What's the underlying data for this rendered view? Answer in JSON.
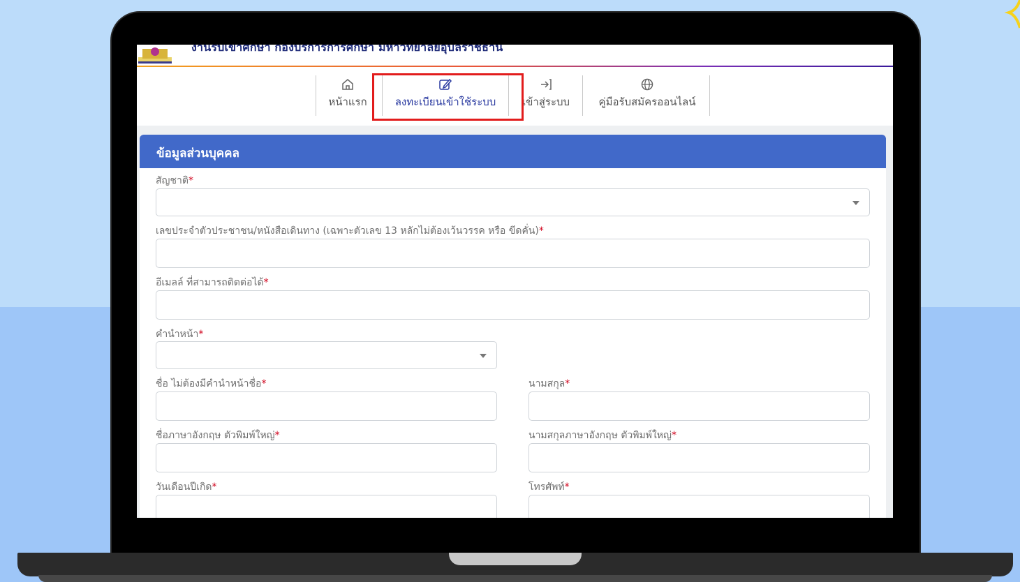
{
  "site": {
    "title": "งานรับเข้าศึกษา กองบริการการศึกษา มหาวิทยาลัยอุบลราชธานี",
    "logo_icon": "university-logo"
  },
  "nav": {
    "items": [
      {
        "label": "หน้าแรก",
        "icon": "home-icon"
      },
      {
        "label": "ลงทะเบียนเข้าใช้ระบบ",
        "icon": "edit-icon"
      },
      {
        "label": "เข้าสู่ระบบ",
        "icon": "login-icon"
      },
      {
        "label": "คู่มือรับสมัครออนไลน์",
        "icon": "globe-icon"
      }
    ],
    "active_index": 1
  },
  "form": {
    "section_title": "ข้อมูลส่วนบุคคล",
    "required_mark": "*",
    "fields": {
      "nationality": {
        "label": "สัญชาติ",
        "value": ""
      },
      "id_number": {
        "label": "เลขประจำตัวประชาชน/หนังสือเดินทาง   (เฉพาะตัวเลข 13 หลักไม่ต้องเว้นวรรค หรือ ขีดคั่น)",
        "value": ""
      },
      "email": {
        "label": "อีเมลล์ ที่สามารถติดต่อได้",
        "value": ""
      },
      "prefix": {
        "label": "คำนำหน้า",
        "value": ""
      },
      "first_name": {
        "label": "ชื่อ  ไม่ต้องมีคำนำหน้าชื่อ",
        "value": ""
      },
      "last_name": {
        "label": "นามสกุล",
        "value": ""
      },
      "first_name_en": {
        "label": "ชื่อภาษาอังกฤษ  ตัวพิมพ์ใหญ่",
        "value": ""
      },
      "last_name_en": {
        "label": "นามสกุลภาษาอังกฤษ  ตัวพิมพ์ใหญ่",
        "value": ""
      },
      "birth_date": {
        "label": "วันเดือนปีเกิด",
        "value": ""
      },
      "phone": {
        "label": "โทรศัพท์",
        "value": ""
      }
    }
  },
  "colors": {
    "header_blue": "#4169c9",
    "highlight_red": "#e21c1c",
    "title_navy": "#1e2a78"
  }
}
